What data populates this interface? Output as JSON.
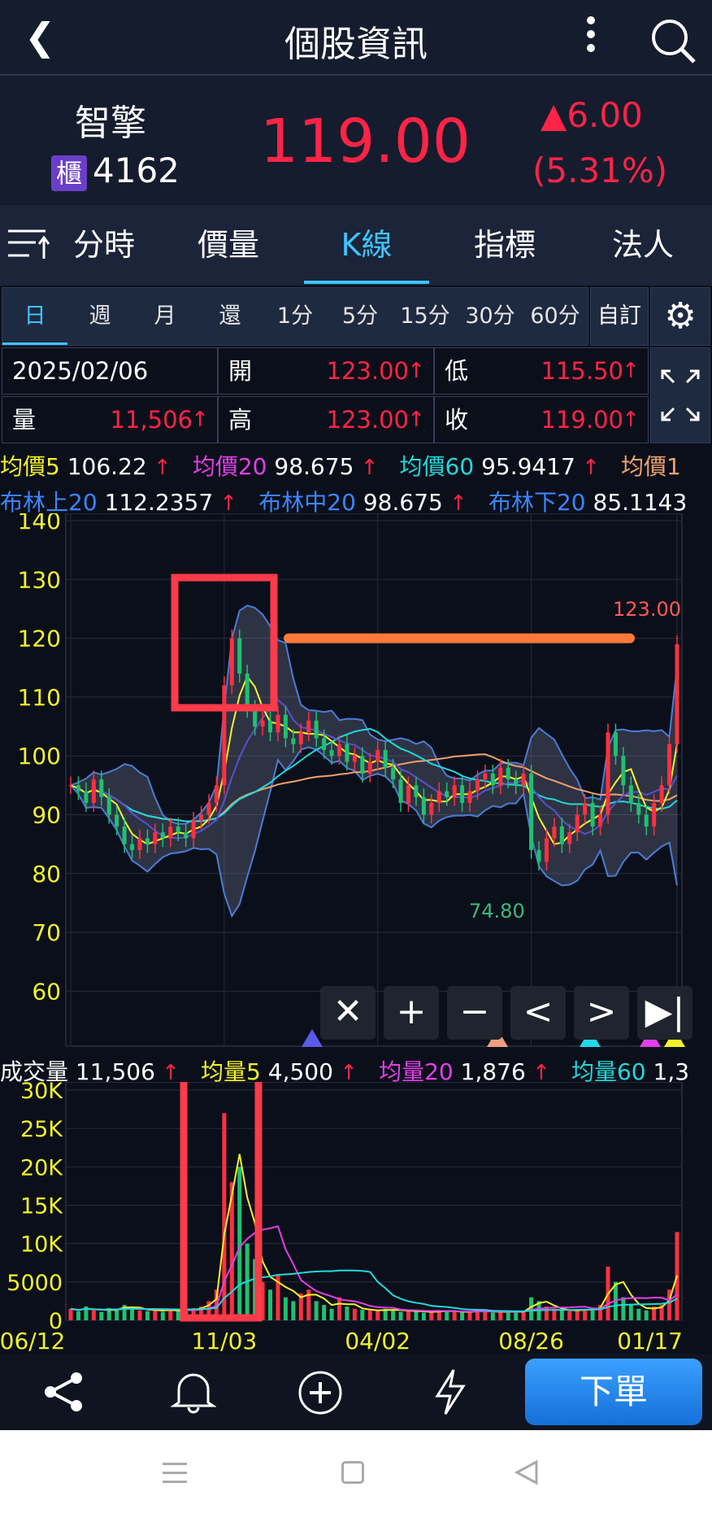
{
  "header": {
    "title": "個股資訊"
  },
  "quote": {
    "name": "智擎",
    "market_badge": "櫃",
    "code": "4162",
    "price": "119.00",
    "change": "6.00",
    "change_pct": "(5.31%)"
  },
  "tabs": [
    {
      "label": "分時"
    },
    {
      "label": "價量"
    },
    {
      "label": "K線"
    },
    {
      "label": "指標"
    },
    {
      "label": "法人"
    }
  ],
  "periods": [
    "日",
    "週",
    "月",
    "還",
    "1分",
    "5分",
    "15分",
    "30分",
    "60分"
  ],
  "custom_label": "自訂",
  "ohlc": {
    "date": "2025/02/06",
    "open_label": "開",
    "open": "123.00",
    "low_label": "低",
    "low": "115.50",
    "vol_label": "量",
    "vol": "11,506",
    "high_label": "高",
    "high": "123.00",
    "close_label": "收",
    "close": "119.00",
    "up_arrow": "↑"
  },
  "ma": [
    {
      "label": "均價5",
      "value": "106.22",
      "color": "#f2f22a"
    },
    {
      "label": "均價20",
      "value": "98.675",
      "color": "#e040e8"
    },
    {
      "label": "均價60",
      "value": "95.9417",
      "color": "#22d8d8"
    },
    {
      "label": "均價1",
      "value": "",
      "color": "#f0a070"
    }
  ],
  "boll": [
    {
      "label": "布林上20",
      "value": "112.2357"
    },
    {
      "label": "布林中20",
      "value": "98.675"
    },
    {
      "label": "布林下20",
      "value": "85.1143"
    }
  ],
  "vol_ma": [
    {
      "label": "成交量",
      "value": "11,506",
      "color": "#fff"
    },
    {
      "label": "均量5",
      "value": "4,500",
      "color": "#f2f22a"
    },
    {
      "label": "均量20",
      "value": "1,876",
      "color": "#e040e8"
    },
    {
      "label": "均量60",
      "value": "1,3",
      "color": "#22d8d8"
    }
  ],
  "chart_data": {
    "type": "candlestick",
    "price_axis": {
      "ticks": [
        140,
        130,
        120,
        110,
        100,
        90,
        80,
        70,
        60
      ],
      "range": [
        55,
        140
      ]
    },
    "volume_axis": {
      "ticks": [
        "30K",
        "25K",
        "20K",
        "15K",
        "10K",
        "5000",
        "0"
      ],
      "range": [
        0,
        30000
      ]
    },
    "x_ticks": [
      {
        "index": 0,
        "label": "06/12"
      },
      {
        "index": 20,
        "label": "11/03"
      },
      {
        "index": 40,
        "label": "04/02"
      },
      {
        "index": 60,
        "label": "08/26"
      },
      {
        "index": 79,
        "label": "01/17"
      }
    ],
    "close": [
      95,
      94,
      92,
      96,
      93,
      90,
      88,
      85,
      84,
      86,
      85,
      87,
      86,
      88,
      87,
      86,
      89,
      90,
      92,
      95,
      112,
      120,
      114,
      108,
      105,
      106,
      104,
      107,
      103,
      102,
      104,
      106,
      103,
      101,
      100,
      102,
      99,
      100,
      97,
      99,
      101,
      98,
      96,
      92,
      95,
      93,
      90,
      92,
      94,
      93,
      95,
      92,
      94,
      96,
      97,
      95,
      98,
      96,
      95,
      97,
      84,
      82,
      86,
      88,
      85,
      87,
      90,
      92,
      88,
      90,
      104,
      100,
      95,
      92,
      90,
      88,
      92,
      95,
      102,
      119
    ],
    "volume": [
      1500,
      1200,
      1800,
      1300,
      1100,
      1600,
      1400,
      2000,
      1700,
      1300,
      1200,
      1500,
      1100,
      1400,
      1300,
      1200,
      1600,
      1800,
      2500,
      4000,
      27000,
      18000,
      20000,
      10000,
      8000,
      5000,
      4000,
      6000,
      3000,
      2500,
      3500,
      4000,
      2500,
      2000,
      1500,
      3000,
      1800,
      1500,
      1400,
      1300,
      1200,
      1500,
      1400,
      1100,
      1300,
      1200,
      1000,
      1100,
      1300,
      1200,
      1100,
      1000,
      1200,
      1300,
      1100,
      1000,
      1200,
      1100,
      1000,
      1200,
      3000,
      2500,
      1800,
      1500,
      1300,
      1200,
      1400,
      1500,
      1300,
      2000,
      7000,
      5000,
      3000,
      2000,
      1500,
      1300,
      1800,
      2000,
      4000,
      11506
    ],
    "high_label": "123.00",
    "low_label": "74.80",
    "annotation_level": 120
  },
  "bottom": {
    "order_label": "下單"
  }
}
